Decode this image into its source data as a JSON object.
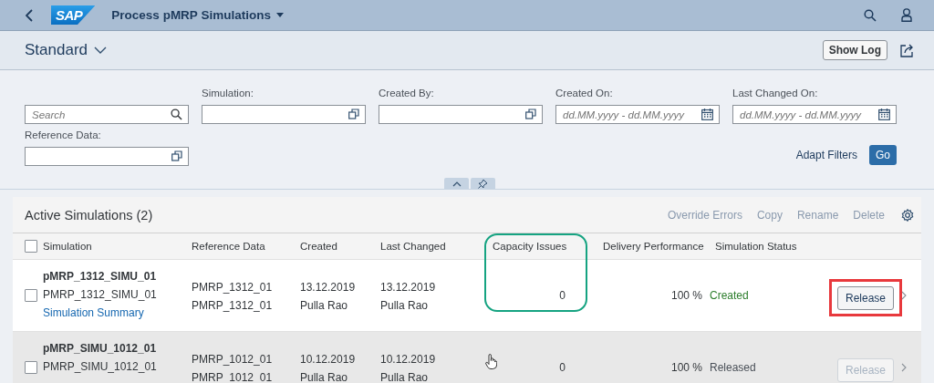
{
  "shell": {
    "logo": "SAP",
    "title": "Process pMRP Simulations"
  },
  "header": {
    "variant": "Standard",
    "show_log": "Show Log"
  },
  "filters": {
    "search": {
      "placeholder": "Search"
    },
    "fields": [
      {
        "label": "Simulation:",
        "kind": "valuehelp"
      },
      {
        "label": "Created By:",
        "kind": "valuehelp"
      },
      {
        "label": "Created On:",
        "kind": "date",
        "placeholder": "dd.MM.yyyy - dd.MM.yyyy"
      },
      {
        "label": "Last Changed On:",
        "kind": "date",
        "placeholder": "dd.MM.yyyy - dd.MM.yyyy"
      },
      {
        "label": "Reference Data:",
        "kind": "valuehelp"
      }
    ],
    "adapt": "Adapt Filters",
    "go": "Go"
  },
  "table": {
    "title": "Active Simulations (2)",
    "select_all_checked": false,
    "actions": [
      {
        "label": "Override Errors",
        "disabled": true
      },
      {
        "label": "Copy",
        "disabled": true
      },
      {
        "label": "Rename",
        "disabled": true
      },
      {
        "label": "Delete",
        "disabled": true
      }
    ],
    "columns": [
      {
        "label": "Simulation",
        "circled": false
      },
      {
        "label": "Reference Data",
        "circled": false
      },
      {
        "label": "Created",
        "circled": false
      },
      {
        "label": "Last Changed",
        "circled": false
      },
      {
        "label": "Capacity Issues",
        "circled": true
      },
      {
        "label": "Delivery Performance",
        "circled": false
      },
      {
        "label": "Simulation Status",
        "circled": false
      }
    ],
    "rows": [
      {
        "checked": false,
        "hovered": false,
        "simulation": "pMRP_1312_SIMU_01",
        "description": "PMRP_1312_SIMU_01",
        "link": "Simulation Summary",
        "reference": [
          "PMRP_1312_01",
          "PMRP_1312_01"
        ],
        "created": [
          "13.12.2019",
          "Pulla Rao"
        ],
        "last_changed": [
          "13.12.2019",
          "Pulla Rao"
        ],
        "capacity_issues": "0",
        "delivery_performance": "100 %",
        "status": "Created",
        "color": "#2b7d2b",
        "action": {
          "label": "Release",
          "disabled": false,
          "boxed": true
        }
      },
      {
        "checked": false,
        "hovered": true,
        "simulation": "pMRP_SIMU_1012_01",
        "description": "PMRP_SIMU_1012_01",
        "reference": [
          "PMRP_1012_01",
          "PMRP_1012_01"
        ],
        "created": [
          "10.12.2019",
          "Pulla Rao"
        ],
        "last_changed": [
          "10.12.2019",
          "Pulla Rao"
        ],
        "capacity_issues": "0",
        "delivery_performance": "100 %",
        "status": "Released",
        "color": "#4a5058",
        "action": {
          "label": "Release",
          "disabled": true,
          "boxed": false
        }
      }
    ]
  }
}
